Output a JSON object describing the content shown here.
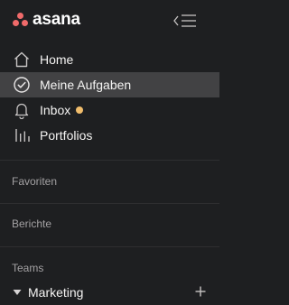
{
  "app": {
    "logo_text": "asana",
    "brand_color": "#f06a6a"
  },
  "header": {
    "collapse_icon": "sidebar-collapse-icon"
  },
  "nav": {
    "items": [
      {
        "label": "Home",
        "icon": "home-icon",
        "active": false
      },
      {
        "label": "Meine Aufgaben",
        "icon": "check-circle-icon",
        "active": true
      },
      {
        "label": "Inbox",
        "icon": "bell-icon",
        "active": false,
        "has_notification": true,
        "notification_color": "#f1bd6c"
      },
      {
        "label": "Portfolios",
        "icon": "bar-chart-icon",
        "active": false
      }
    ]
  },
  "sections": {
    "favorites": "Favoriten",
    "reports": "Berichte",
    "teams": "Teams"
  },
  "teams": [
    {
      "label": "Marketing",
      "expanded": true,
      "add_icon": "plus-icon"
    }
  ]
}
